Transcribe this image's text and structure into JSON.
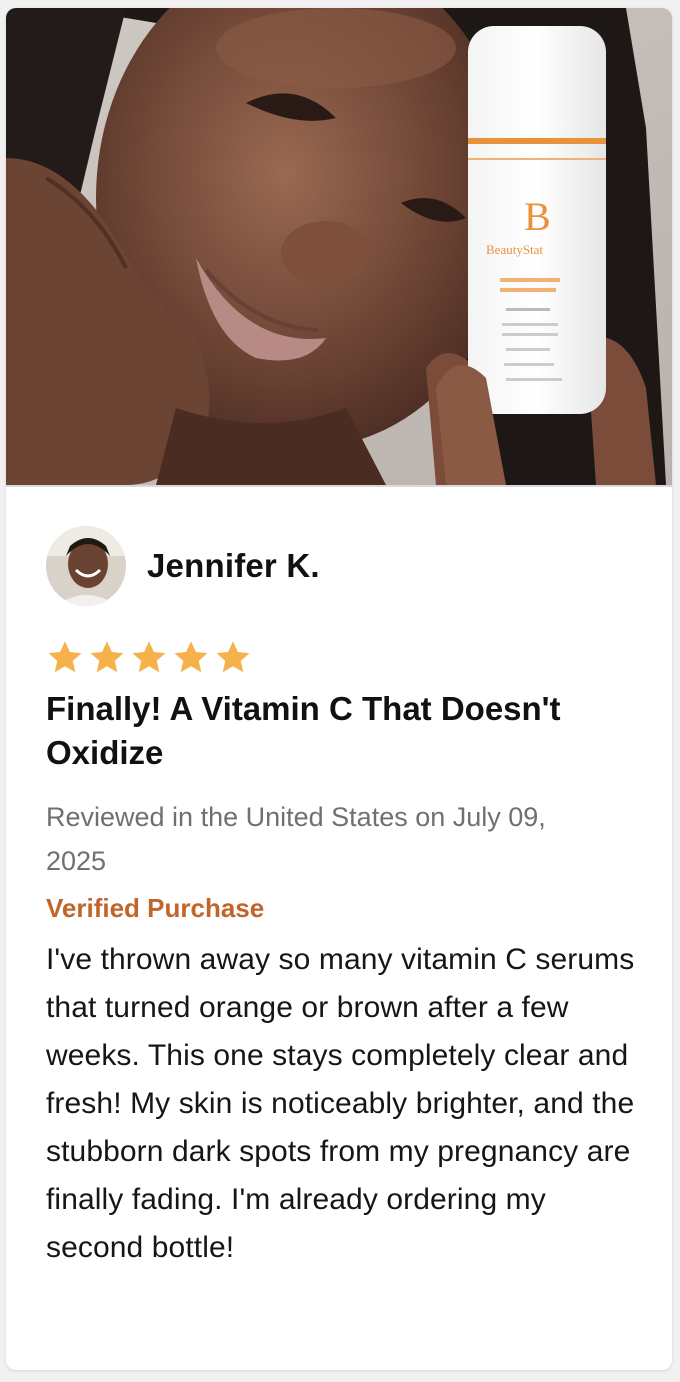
{
  "review": {
    "reviewer_name": "Jennifer K.",
    "rating": 5,
    "max_rating": 5,
    "title": "Finally! A Vitamin C That Doesn't Oxidize",
    "meta_text": "Reviewed in the United States on July 09, 2025",
    "verified_label": "Verified Purchase",
    "body": "I've thrown away so many vitamin C serums that turned orange or brown after a few weeks. This one stays completely clear and fresh! My skin is noticeably brighter, and the stubborn dark spots from my pregnancy are finally fading. I'm already ordering my second bottle!"
  },
  "product_photo": {
    "brand_mark": "B",
    "brand_name": "BeautyStat"
  },
  "colors": {
    "star": "#f6b24a",
    "verified": "#c1652a",
    "title": "#111111",
    "meta": "#707070",
    "brand_accent": "#e8933b"
  },
  "icons": {
    "star": "star-icon",
    "avatar": "avatar-photo"
  }
}
